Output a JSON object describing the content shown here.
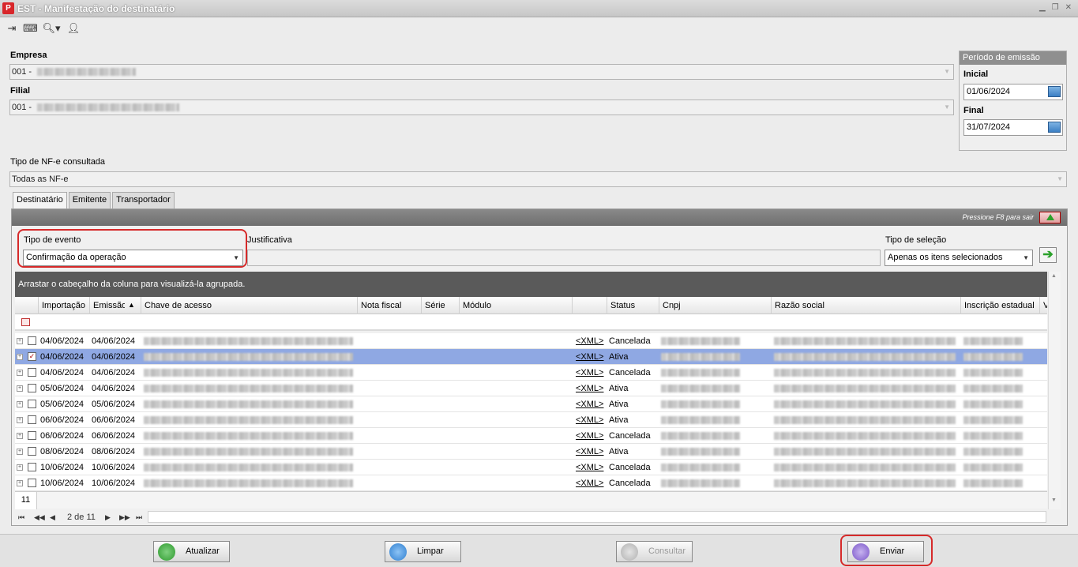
{
  "window": {
    "title": "EST - Manifestação do destinatário",
    "app_logo": "P"
  },
  "toolbar": {
    "icons": [
      "exit-icon",
      "keyboard-icon",
      "search-icon",
      "user-icon"
    ]
  },
  "empresa": {
    "label": "Empresa",
    "value_prefix": "001 -"
  },
  "filial": {
    "label": "Filial",
    "value_prefix": "001 -"
  },
  "periodo": {
    "title": "Período de emissão",
    "inicial_label": "Inicial",
    "inicial": "01/06/2024",
    "final_label": "Final",
    "final": "31/07/2024"
  },
  "tipo_nfe": {
    "label": "Tipo de NF-e consultada",
    "value": "Todas as NF-e"
  },
  "tabs": [
    {
      "label": "Destinatário",
      "active": true
    },
    {
      "label": "Emitente",
      "active": false
    },
    {
      "label": "Transportador",
      "active": false
    }
  ],
  "panel": {
    "hint": "Pressione F8 para sair"
  },
  "evento": {
    "label": "Tipo de evento",
    "value": "Confirmação da operação"
  },
  "justificativa": {
    "label": "Justificativa",
    "value": ""
  },
  "selecao": {
    "label": "Tipo de seleção",
    "value": "Apenas os itens selecionados"
  },
  "grid": {
    "group_hint": "Arrastar o cabeçalho da coluna para visualizá-la agrupada.",
    "columns": [
      "Importação",
      "Emissão",
      "Chave de acesso",
      "Nota fiscal",
      "Série",
      "Módulo",
      "",
      "Status",
      "Cnpj",
      "Razão social",
      "Inscrição estadual",
      "V"
    ],
    "sort_indicator": "▲",
    "rows": [
      {
        "importacao": "04/06/2024",
        "emissao": "04/06/2024",
        "xml": "<XML>",
        "status": "Cancelada",
        "checked": false,
        "selected": false
      },
      {
        "importacao": "04/06/2024",
        "emissao": "04/06/2024",
        "xml": "<XML>",
        "status": "Ativa",
        "checked": true,
        "selected": true
      },
      {
        "importacao": "04/06/2024",
        "emissao": "04/06/2024",
        "xml": "<XML>",
        "status": "Cancelada",
        "checked": false,
        "selected": false
      },
      {
        "importacao": "05/06/2024",
        "emissao": "04/06/2024",
        "xml": "<XML>",
        "status": "Ativa",
        "checked": false,
        "selected": false
      },
      {
        "importacao": "05/06/2024",
        "emissao": "05/06/2024",
        "xml": "<XML>",
        "status": "Ativa",
        "checked": false,
        "selected": false
      },
      {
        "importacao": "06/06/2024",
        "emissao": "06/06/2024",
        "xml": "<XML>",
        "status": "Ativa",
        "checked": false,
        "selected": false
      },
      {
        "importacao": "06/06/2024",
        "emissao": "06/06/2024",
        "xml": "<XML>",
        "status": "Cancelada",
        "checked": false,
        "selected": false
      },
      {
        "importacao": "08/06/2024",
        "emissao": "08/06/2024",
        "xml": "<XML>",
        "status": "Ativa",
        "checked": false,
        "selected": false
      },
      {
        "importacao": "10/06/2024",
        "emissao": "10/06/2024",
        "xml": "<XML>",
        "status": "Cancelada",
        "checked": false,
        "selected": false
      },
      {
        "importacao": "10/06/2024",
        "emissao": "10/06/2024",
        "xml": "<XML>",
        "status": "Cancelada",
        "checked": false,
        "selected": false
      }
    ],
    "count": "11",
    "pager": "2 de 11"
  },
  "buttons": {
    "atualizar": "Atualizar",
    "limpar": "Limpar",
    "consultar": "Consultar",
    "enviar": "Enviar"
  },
  "colors": {
    "highlight": "#d62a2a",
    "selected_row": "#8fa8e3",
    "panel_header": "#7a7a7a"
  }
}
